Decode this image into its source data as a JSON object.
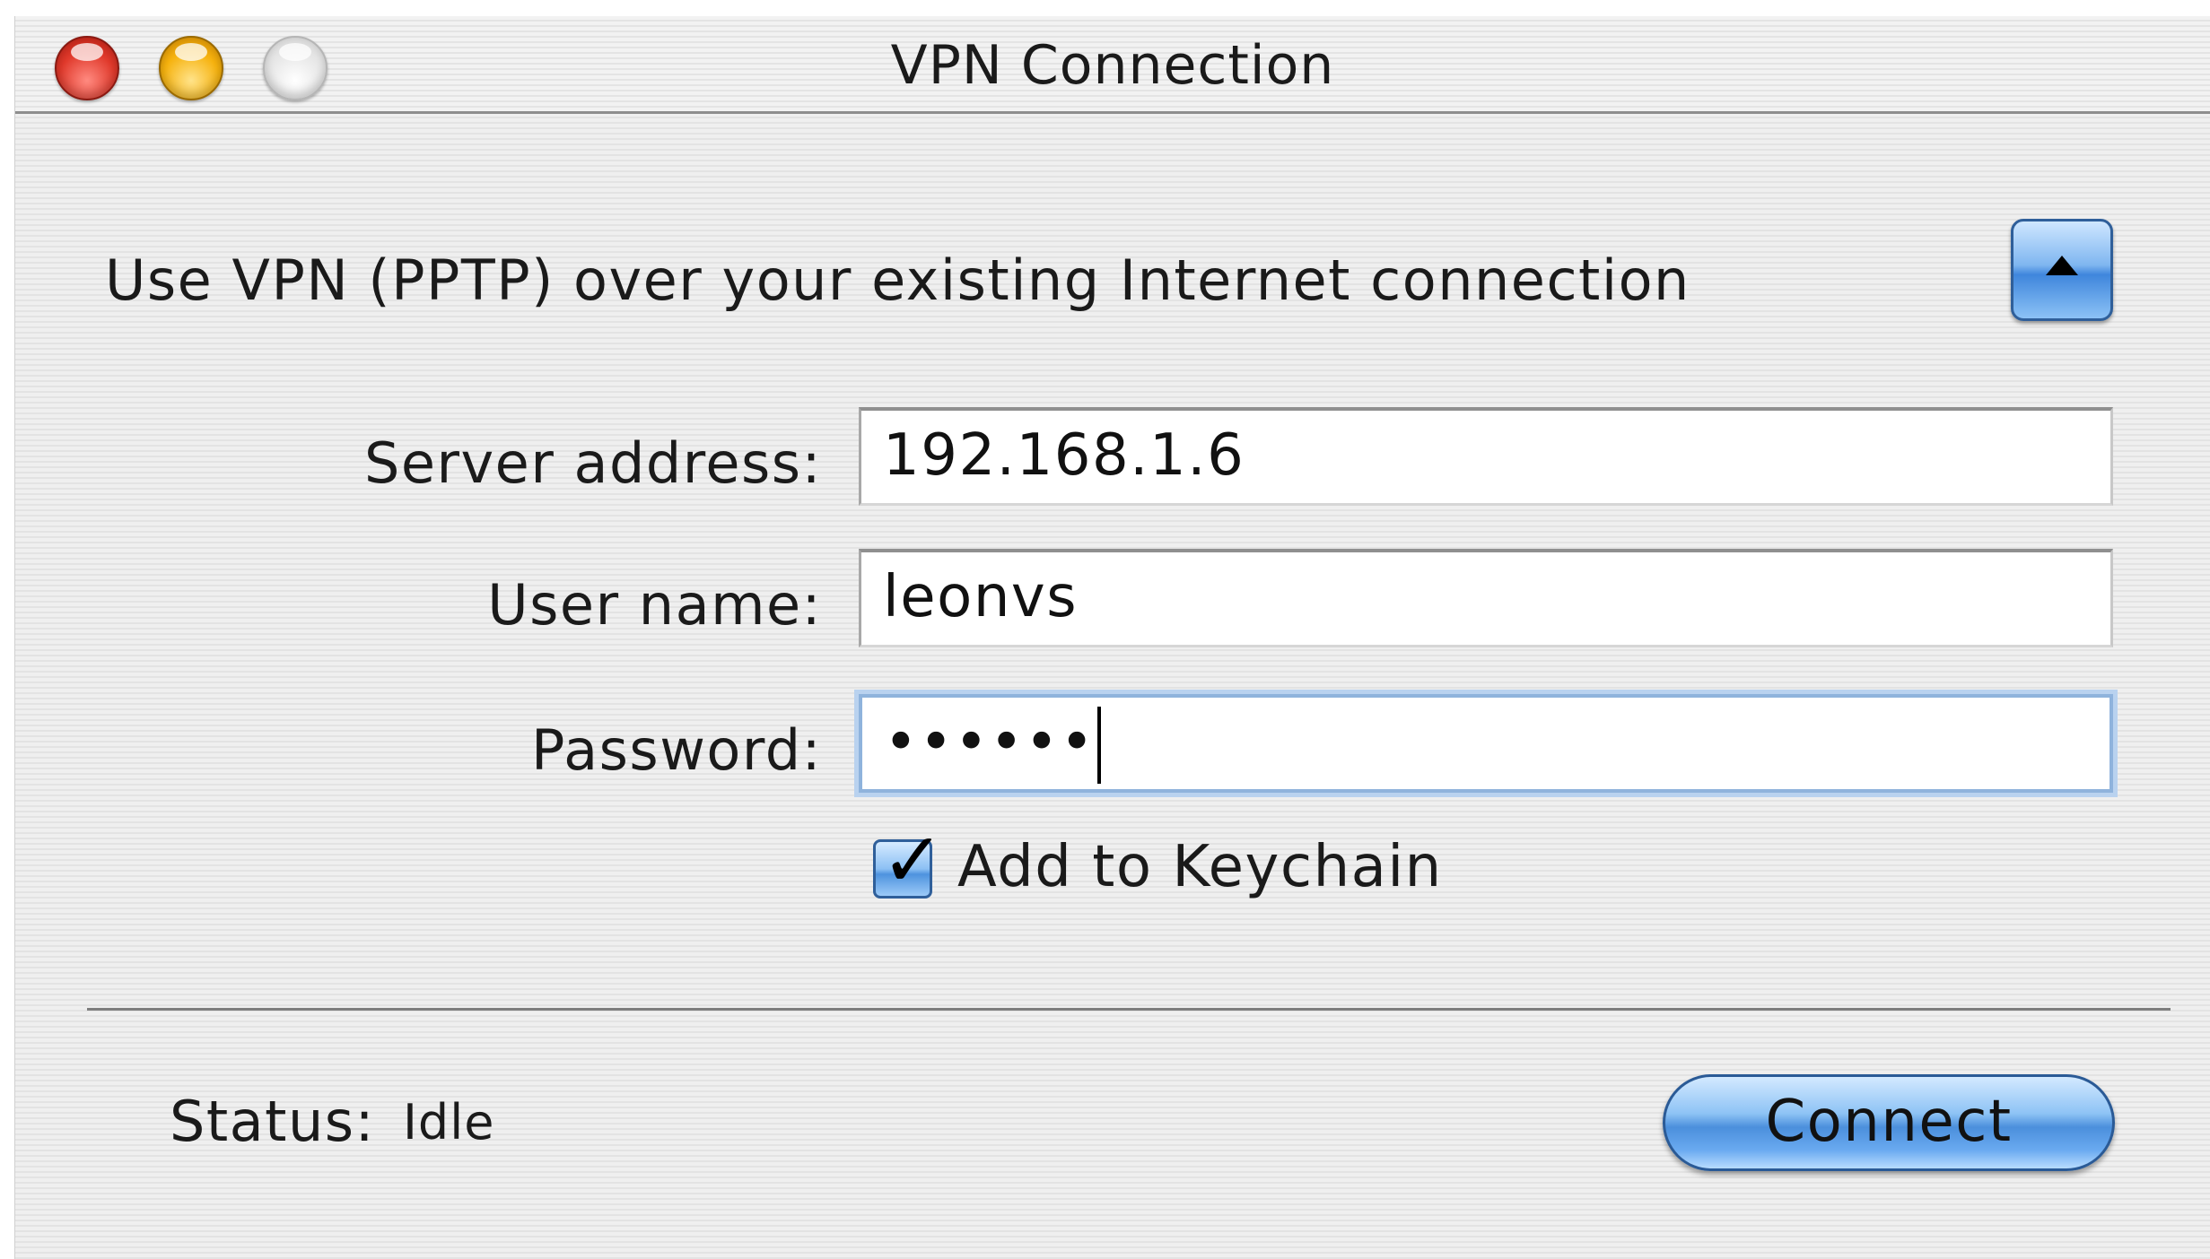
{
  "window": {
    "title": "VPN Connection"
  },
  "header": {
    "description": "Use VPN (PPTP) over your existing Internet connection",
    "disclosure_icon": "triangle-up-icon"
  },
  "form": {
    "server_label": "Server address:",
    "server_value": "192.168.1.6",
    "username_label": "User name:",
    "username_value": "leonvs",
    "password_label": "Password:",
    "password_value": "••••••",
    "keychain_label": "Add to Keychain",
    "keychain_checked": true
  },
  "footer": {
    "status_label": "Status:",
    "status_value": "Idle",
    "connect_label": "Connect"
  },
  "colors": {
    "aqua_blue": "#4b8fdc",
    "close_red": "#e0392b",
    "minimize_yellow": "#f6b20e"
  }
}
